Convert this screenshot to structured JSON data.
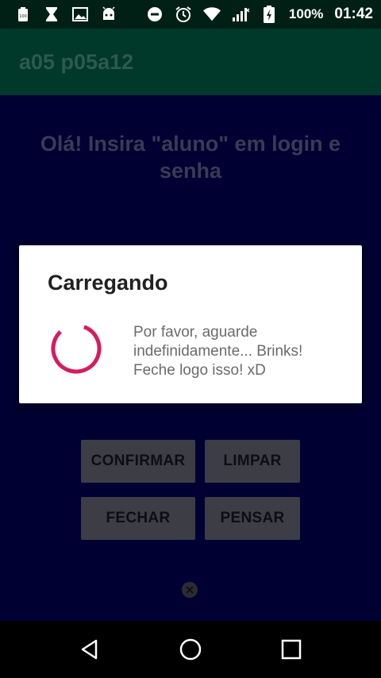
{
  "status_bar": {
    "left_icons": [
      "notification-icon",
      "hourglass-icon",
      "image-icon",
      "android-icon"
    ],
    "battery_percent": "100%",
    "time": "01:42"
  },
  "app_bar": {
    "title": "a05 p05a12"
  },
  "main": {
    "headline": "Olá! Insira \"aluno\" em login e senha",
    "buttons": {
      "confirmar": "CONFIRMAR",
      "limpar": "LIMPAR",
      "fechar": "FECHAR",
      "pensar": "PENSAR"
    }
  },
  "dialog": {
    "title": "Carregando",
    "message": "Por favor, aguarde indefinidamente... Brinks! Feche logo isso! xD"
  },
  "colors": {
    "status_bar": "#002016",
    "app_bar": "#00382a",
    "content_bg": "#000033",
    "spinner": "#d81b60"
  }
}
